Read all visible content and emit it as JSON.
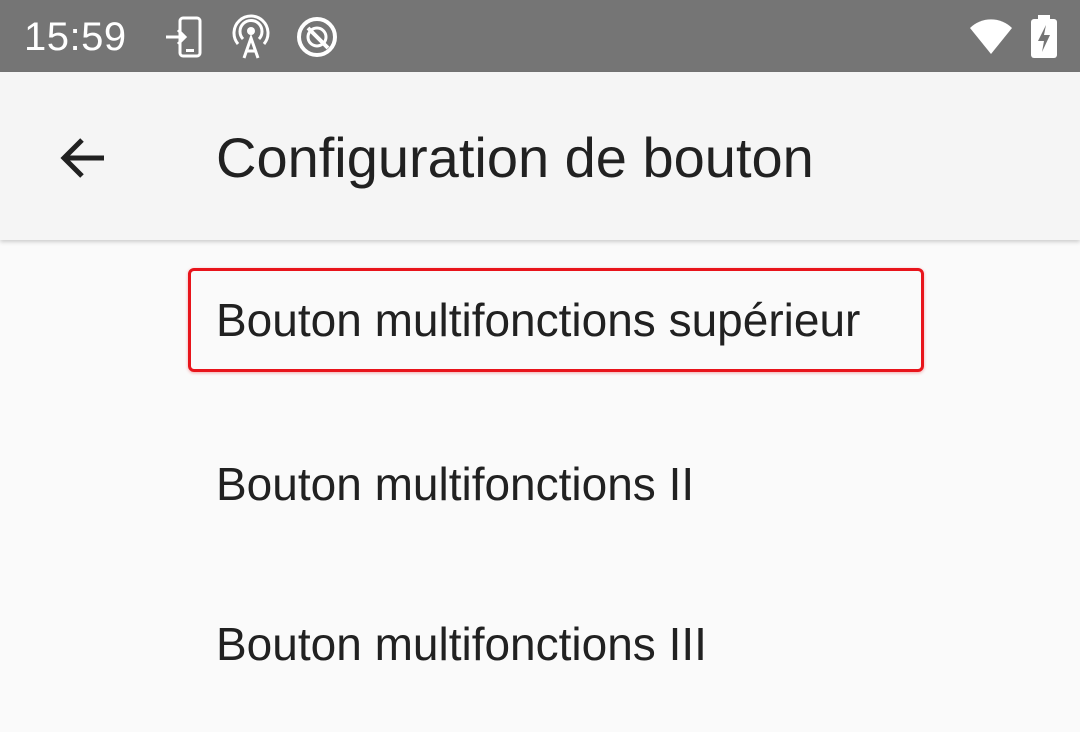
{
  "status_bar": {
    "time": "15:59",
    "icons_left": [
      "phone-login-icon",
      "hotspot-icon",
      "do-not-disturb-icon"
    ],
    "icons_right": [
      "wifi-icon",
      "battery-charging-icon"
    ]
  },
  "app_bar": {
    "back_icon": "arrow-left-icon",
    "title": "Configuration de bouton"
  },
  "list": {
    "items": [
      {
        "label": "Bouton multifonctions supérieur",
        "highlighted": true
      },
      {
        "label": "Bouton multifonctions II",
        "highlighted": false
      },
      {
        "label": "Bouton multifonctions III",
        "highlighted": false
      }
    ]
  },
  "colors": {
    "status_bar": "#757575",
    "app_bar": "#f5f5f5",
    "background": "#fafafa",
    "text": "#212121",
    "highlight": "#e8141b"
  }
}
